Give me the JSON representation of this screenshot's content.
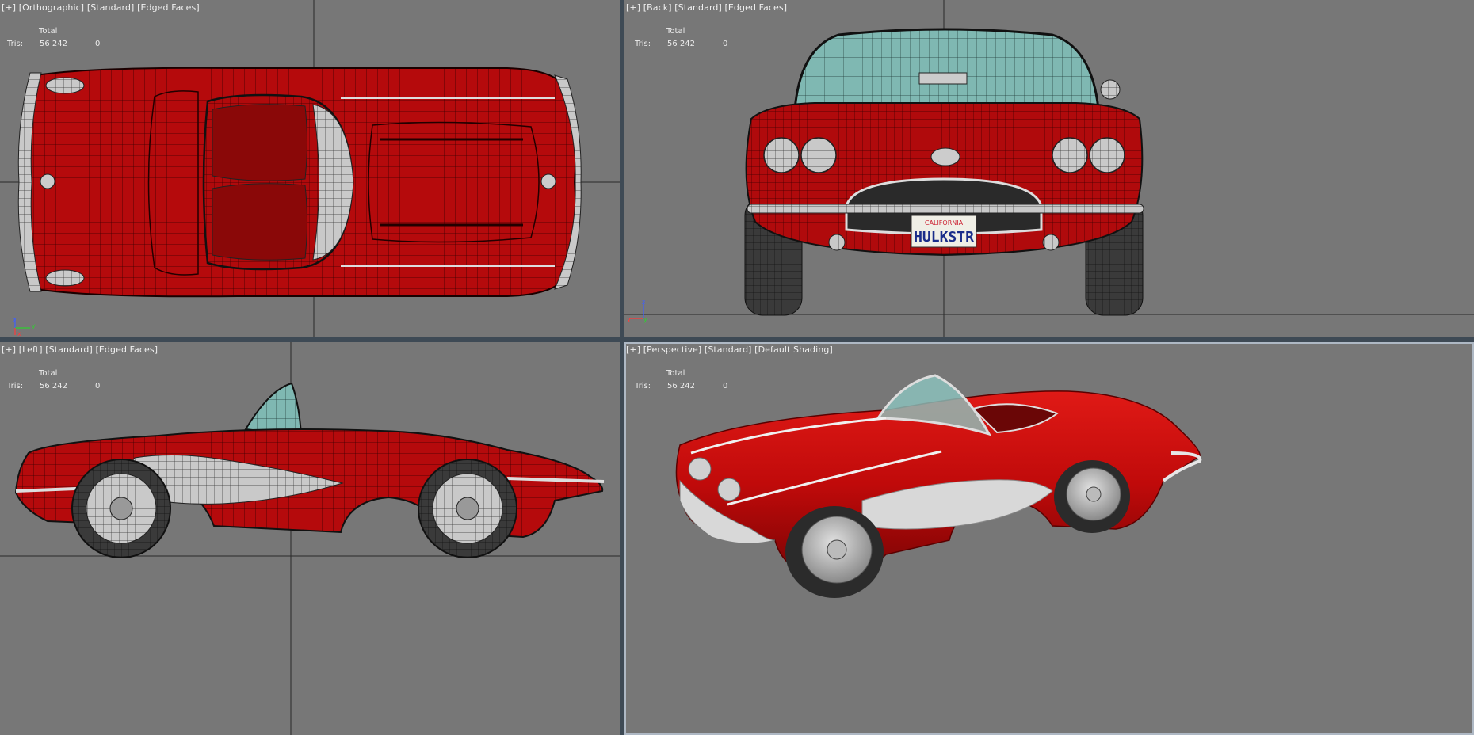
{
  "viewports": {
    "top": {
      "menu": "[+]",
      "view": "[Orthographic]",
      "shading": "[Standard]",
      "mode": "[Edged Faces]",
      "stats": {
        "header": "Total",
        "label": "Tris:",
        "value": "56 242",
        "selected": "0"
      },
      "axes": {
        "a": "z",
        "b": "y",
        "c": "x"
      }
    },
    "front": {
      "menu": "[+]",
      "view": "[Back]",
      "shading": "[Standard]",
      "mode": "[Edged Faces]",
      "stats": {
        "header": "Total",
        "label": "Tris:",
        "value": "56 242",
        "selected": "0"
      },
      "axes": {
        "a": "z",
        "b": "y",
        "c": "x"
      },
      "plate": {
        "state": "CALIFORNIA",
        "number": "HULKSTR"
      }
    },
    "left": {
      "menu": "[+]",
      "view": "[Left]",
      "shading": "[Standard]",
      "mode": "[Edged Faces]",
      "stats": {
        "header": "Total",
        "label": "Tris:",
        "value": "56 242",
        "selected": "0"
      }
    },
    "perspective": {
      "menu": "[+]",
      "view": "[Perspective]",
      "shading": "[Standard]",
      "mode": "[Default Shading]",
      "stats": {
        "header": "Total",
        "label": "Tris:",
        "value": "56 242",
        "selected": "0"
      }
    }
  },
  "colors": {
    "viewport_bg": "#777777",
    "body_red": "#b8080c",
    "wire": "#2a0000",
    "chrome": "#d9d9d9",
    "glass": "#7fb6b2",
    "tire": "#2e2e2e"
  }
}
